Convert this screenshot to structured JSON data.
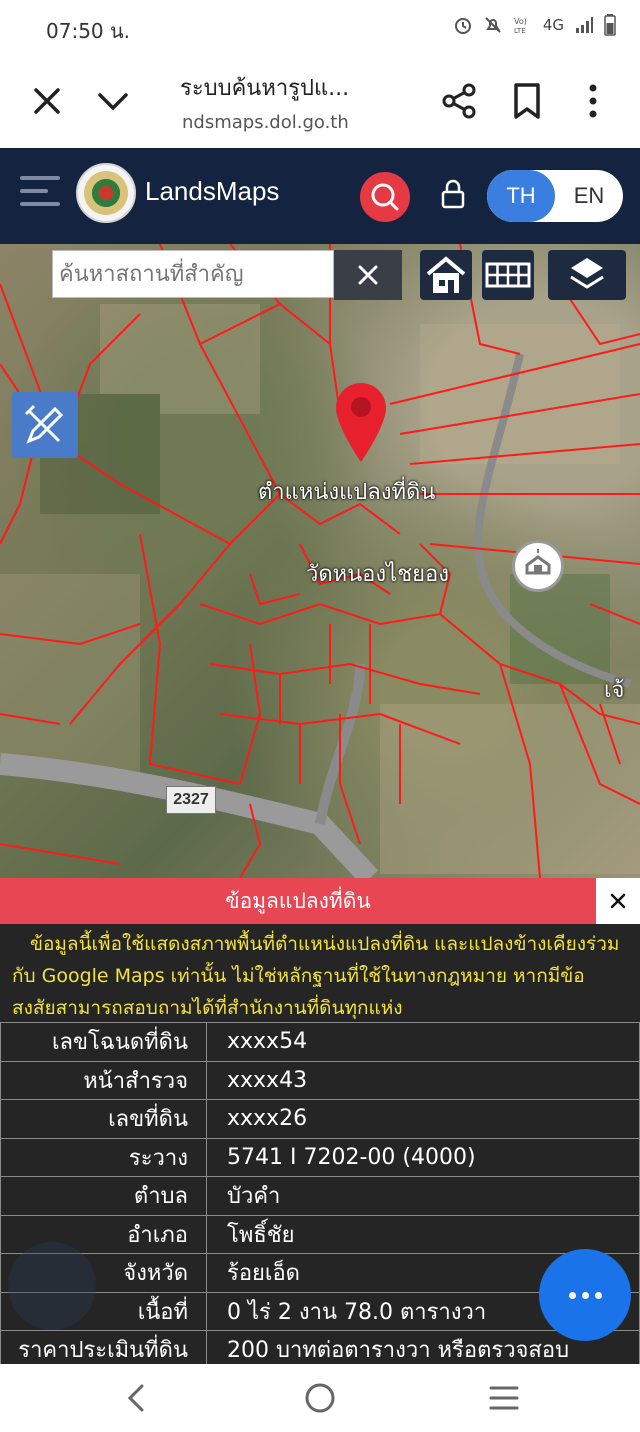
{
  "status_bar": {
    "time": "07:50 น.",
    "network": "4G",
    "icons": [
      "alarm-icon",
      "mute-icon",
      "volte-icon",
      "signal-icon",
      "battery-icon"
    ]
  },
  "browser": {
    "title": "ระบบค้นหารูปแ...",
    "url": "ndsmaps.dol.go.th",
    "icons": [
      "close-icon",
      "chevron-down-icon",
      "share-icon",
      "bookmark-icon",
      "more-icon"
    ]
  },
  "app_header": {
    "brand": "LandsMaps",
    "lang_th": "TH",
    "lang_en": "EN",
    "colors": {
      "header_bg": "#142340",
      "search_btn": "#e53a44",
      "active_lang": "#3a7ee0"
    }
  },
  "map": {
    "search_placeholder": "ค้นหาสถานที่สำคัญ",
    "pin_label": "ตำแหน่งแปลงที่ดิน",
    "place_label": "วัดหนองไชยอง",
    "edge_label": "เจ้",
    "road_number": "2327",
    "parcel_line_color": "#ff1a1a",
    "icons": [
      "clear-icon",
      "home-icon",
      "grid-icon",
      "layers-icon",
      "draw-tool-icon",
      "location-pin-icon",
      "temple-icon"
    ]
  },
  "info_panel": {
    "title": "ข้อมูลแปลงที่ดิน",
    "close_label": "✕",
    "disclaimer": "ข้อมูลนี้เพื่อใช้แสดงสภาพพื้นที่ตำแหน่งแปลงที่ดิน และแปลงข้างเคียงร่วมกับ Google Maps เท่านั้น ไม่ใช่หลักฐานที่ใช้ในทางกฎหมาย หากมีข้อสงสัยสามารถสอบถามได้ที่สำนักงานที่ดินทุกแห่ง",
    "rows": [
      {
        "label": "เลขโฉนดที่ดิน",
        "value": "xxxx54"
      },
      {
        "label": "หน้าสำรวจ",
        "value": "xxxx43"
      },
      {
        "label": "เลขที่ดิน",
        "value": "xxxx26"
      },
      {
        "label": "ระวาง",
        "value": "5741 I 7202-00 (4000)"
      },
      {
        "label": "ตำบล",
        "value": "บัวคำ"
      },
      {
        "label": "อำเภอ",
        "value": "โพธิ์ชัย"
      },
      {
        "label": "จังหวัด",
        "value": "ร้อยเอ็ด"
      },
      {
        "label": "เนื้อที่",
        "value": "0 ไร่ 2 งาน 78.0 ตารางวา"
      },
      {
        "label": "ราคาประเมินที่ดิน",
        "value": "200 บาทต่อตารางวา หรือตรวจสอบ"
      }
    ],
    "colors": {
      "header": "#e74652",
      "disclaimer_text": "#f2e23c",
      "fab": "#1a73e8"
    }
  },
  "nav_bar": {
    "icons": [
      "back-icon",
      "home-circle-icon",
      "recents-icon"
    ]
  }
}
